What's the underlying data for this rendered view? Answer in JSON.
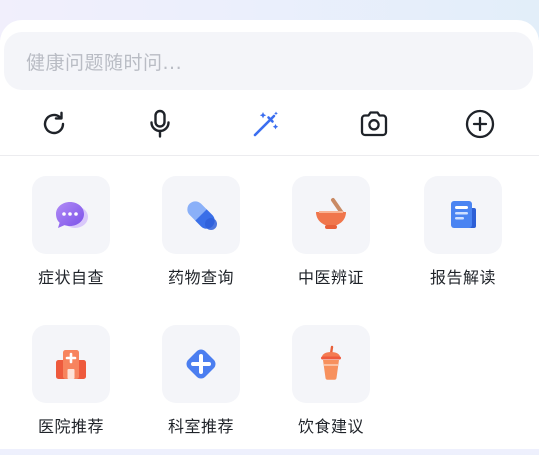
{
  "search": {
    "placeholder": "健康问题随时问..."
  },
  "toolbar": {
    "items": [
      {
        "name": "refresh",
        "icon": "refresh-icon"
      },
      {
        "name": "voice",
        "icon": "microphone-icon"
      },
      {
        "name": "magic",
        "icon": "magic-wand-icon"
      },
      {
        "name": "camera",
        "icon": "camera-icon"
      },
      {
        "name": "add",
        "icon": "plus-circle-icon"
      }
    ]
  },
  "services": [
    {
      "label": "症状自查",
      "icon": "chat-bubbles-icon",
      "color": "#8f6cf0"
    },
    {
      "label": "药物查询",
      "icon": "pill-capsule-icon",
      "color": "#3a6fe8"
    },
    {
      "label": "中医辨证",
      "icon": "mortar-bowl-icon",
      "color": "#f0764c"
    },
    {
      "label": "报告解读",
      "icon": "report-document-icon",
      "color": "#3c7cf0"
    },
    {
      "label": "医院推荐",
      "icon": "hospital-icon",
      "color": "#ee5a3d"
    },
    {
      "label": "科室推荐",
      "icon": "medical-cross-icon",
      "color": "#4b7ef0"
    },
    {
      "label": "饮食建议",
      "icon": "drink-cup-icon",
      "color": "#f0703f"
    }
  ],
  "colors": {
    "accent": "#3b6ef0",
    "text": "#1f2329",
    "placeholder": "#b9bcc4",
    "tile_bg": "#f4f5f9"
  }
}
